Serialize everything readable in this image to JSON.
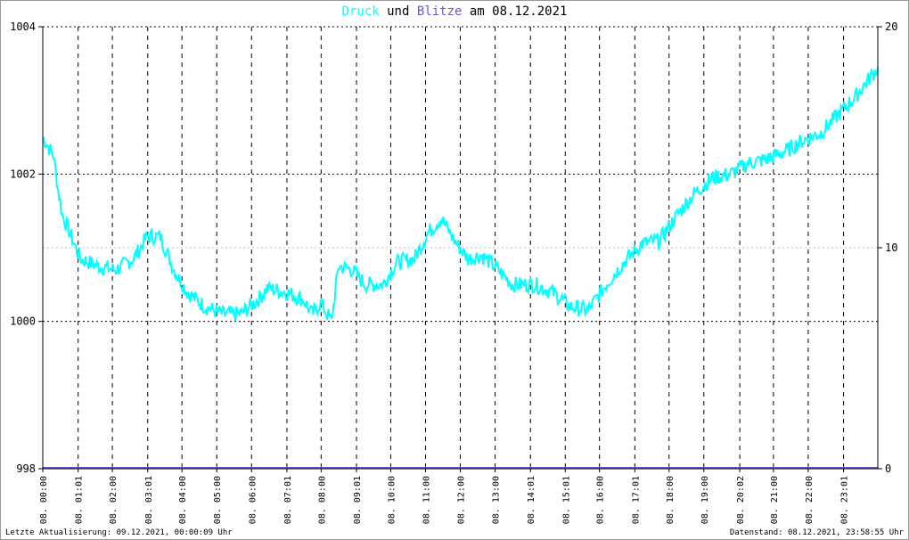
{
  "title": {
    "part1": "Druck",
    "part2": " und ",
    "part3": "Blitze",
    "part4": " am 08.12.2021"
  },
  "colors": {
    "pressure": "#00ffff",
    "lightning": "#6a5acd",
    "axis": "#000000"
  },
  "footer": {
    "left": "Letzte Aktualisierung: 09.12.2021, 00:00:09 Uhr",
    "right": "Datenstand: 08.12.2021, 23:58:55 Uhr"
  },
  "chart_data": {
    "type": "line",
    "title": "Druck und Blitze am 08.12.2021",
    "x_range_hours": [
      0,
      24
    ],
    "y_left": {
      "label": "Druck",
      "range": [
        998,
        1004
      ],
      "ticks": [
        998,
        1000,
        1002,
        1004
      ]
    },
    "y_right": {
      "label": "Blitze",
      "range": [
        0,
        20
      ],
      "ticks": [
        0,
        10,
        20
      ]
    },
    "x_ticks": [
      "08. 00:00",
      "08. 01:01",
      "08. 02:00",
      "08. 03:01",
      "08. 04:00",
      "08. 05:00",
      "08. 06:00",
      "08. 07:01",
      "08. 08:00",
      "08. 09:01",
      "08. 10:00",
      "08. 11:00",
      "08. 12:00",
      "08. 13:00",
      "08. 14:01",
      "08. 15:01",
      "08. 16:00",
      "08. 17:01",
      "08. 18:00",
      "08. 19:00",
      "08. 20:02",
      "08. 21:00",
      "08. 22:00",
      "08. 23:01"
    ],
    "series": [
      {
        "name": "Druck",
        "axis": "left",
        "points": [
          [
            0,
            1002.5
          ],
          [
            0.31,
            1002.25
          ],
          [
            0.44,
            1001.8
          ],
          [
            0.56,
            1001.45
          ],
          [
            0.82,
            1001.15
          ],
          [
            1.08,
            1000.85
          ],
          [
            1.59,
            1000.75
          ],
          [
            2.1,
            1000.7
          ],
          [
            2.61,
            1000.85
          ],
          [
            3.0,
            1001.15
          ],
          [
            3.38,
            1001.15
          ],
          [
            3.77,
            1000.7
          ],
          [
            4.15,
            1000.4
          ],
          [
            4.66,
            1000.2
          ],
          [
            5.17,
            1000.1
          ],
          [
            5.69,
            1000.1
          ],
          [
            6.2,
            1000.3
          ],
          [
            6.45,
            1000.45
          ],
          [
            6.97,
            1000.4
          ],
          [
            7.48,
            1000.3
          ],
          [
            7.74,
            1000.1
          ],
          [
            7.99,
            1000.25
          ],
          [
            8.3,
            1000.0
          ],
          [
            8.5,
            1000.75
          ],
          [
            8.89,
            1000.7
          ],
          [
            9.27,
            1000.5
          ],
          [
            9.78,
            1000.5
          ],
          [
            10.17,
            1000.8
          ],
          [
            10.68,
            1000.85
          ],
          [
            11.07,
            1001.2
          ],
          [
            11.45,
            1001.4
          ],
          [
            11.83,
            1001.1
          ],
          [
            12.22,
            1000.85
          ],
          [
            12.6,
            1000.9
          ],
          [
            12.99,
            1000.75
          ],
          [
            13.5,
            1000.5
          ],
          [
            14.14,
            1000.5
          ],
          [
            14.65,
            1000.4
          ],
          [
            15.16,
            1000.2
          ],
          [
            15.68,
            1000.15
          ],
          [
            16.19,
            1000.5
          ],
          [
            16.7,
            1000.8
          ],
          [
            17.21,
            1001.05
          ],
          [
            17.73,
            1001.1
          ],
          [
            18.24,
            1001.45
          ],
          [
            18.75,
            1001.75
          ],
          [
            19.26,
            1001.95
          ],
          [
            19.77,
            1002.0
          ],
          [
            20.29,
            1002.15
          ],
          [
            20.8,
            1002.2
          ],
          [
            21.31,
            1002.3
          ],
          [
            21.82,
            1002.45
          ],
          [
            22.34,
            1002.55
          ],
          [
            22.85,
            1002.8
          ],
          [
            23.36,
            1003.05
          ],
          [
            24,
            1003.45
          ]
        ]
      },
      {
        "name": "Blitze",
        "axis": "right",
        "points": [
          [
            0,
            0
          ],
          [
            24,
            0
          ]
        ]
      }
    ]
  }
}
